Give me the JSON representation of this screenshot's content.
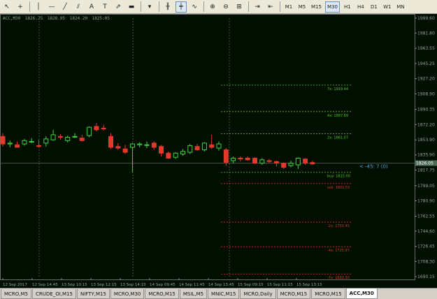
{
  "toolbar": {
    "tools": [
      {
        "name": "cursor-icon",
        "glyph": "↖",
        "active": false
      },
      {
        "name": "crosshair-icon",
        "glyph": "+",
        "active": false
      },
      {
        "name": "vertical-line-icon",
        "glyph": "│",
        "active": false
      },
      {
        "name": "horizontal-line-icon",
        "glyph": "—",
        "active": false
      },
      {
        "name": "trendline-icon",
        "glyph": "╱",
        "active": false
      },
      {
        "name": "channel-icon",
        "glyph": "⫽",
        "active": false
      },
      {
        "name": "text-icon",
        "glyph": "A",
        "active": false
      },
      {
        "name": "text-label-icon",
        "glyph": "T",
        "active": false
      },
      {
        "name": "arrow-tool-icon",
        "glyph": "⇗",
        "active": false
      },
      {
        "name": "chart-type-icon",
        "glyph": "▬",
        "active": false
      },
      {
        "name": "dropdown-icon",
        "glyph": "▾",
        "active": false
      }
    ],
    "chart_tools": [
      {
        "name": "bar-chart-icon",
        "glyph": "╫",
        "active": false
      },
      {
        "name": "candlestick-icon",
        "glyph": "╪",
        "active": true
      },
      {
        "name": "line-chart-icon",
        "glyph": "∿",
        "active": false
      },
      {
        "name": "zoom-in-icon",
        "glyph": "⊕",
        "active": false
      },
      {
        "name": "zoom-out-icon",
        "glyph": "⊖",
        "active": false
      },
      {
        "name": "tile-windows-icon",
        "glyph": "⊞",
        "active": false
      },
      {
        "name": "autoscroll-icon",
        "glyph": "⇥",
        "active": false
      },
      {
        "name": "chart-shift-icon",
        "glyph": "⇤",
        "active": false
      }
    ],
    "timeframes": [
      "M1",
      "M5",
      "M15",
      "M30",
      "H1",
      "H4",
      "D1",
      "W1",
      "MN"
    ],
    "active_timeframe": "M30"
  },
  "chart": {
    "ohlc_header": [
      "ACC,M30",
      "1826.75",
      "1828.95",
      "1824.20",
      "1825.05"
    ],
    "price_ticks": [
      "1999.60",
      "1981.80",
      "1963.55",
      "1945.25",
      "1927.20",
      "1908.90",
      "1890.35",
      "1872.20",
      "1853.90",
      "1835.90",
      "1817.75",
      "1799.05",
      "1780.90",
      "1762.55",
      "1744.60",
      "1726.45",
      "1708.30",
      "1690.15"
    ],
    "time_ticks": [
      "12 Sep 2017",
      "12 Sep 14:45",
      "13 Sep 10:15",
      "13 Sep 12:15",
      "13 Sep 14:15",
      "14 Sep 09:45",
      "14 Sep 11:45",
      "14 Sep 13:45",
      "15 Sep 09:15",
      "15 Sep 11:15",
      "15 Sep 13:15"
    ],
    "current_price_label": "1826.05",
    "trade_annotation": "< -45: 7 (0)",
    "levels": [
      {
        "label": "7x: 1919.44",
        "color": "#4cc81f"
      },
      {
        "label": "4x: 1887.69",
        "color": "#4cc81f"
      },
      {
        "label": "2x: 1861.07",
        "color": "#4cc81f"
      },
      {
        "label": "buy: 1815.00",
        "color": "#4cc81f"
      },
      {
        "label": "sell: 1801.55",
        "color": "#e03020"
      },
      {
        "label": "-2x: 1755.45",
        "color": "#e03020"
      },
      {
        "label": "-4x: 1725.97",
        "color": "#e03020"
      },
      {
        "label": "-7x: 1693.30",
        "color": "#e03020"
      }
    ]
  },
  "chart_data": {
    "type": "candlestick",
    "symbol": "ACC",
    "timeframe": "M30",
    "ylim": [
      1690.15,
      1999.6
    ],
    "bull_color": "#3ed23e",
    "bear_color": "#e23a2a",
    "candles": [
      {
        "o": 1858,
        "h": 1862,
        "l": 1846,
        "c": 1849
      },
      {
        "o": 1849,
        "h": 1853,
        "l": 1845,
        "c": 1850
      },
      {
        "o": 1848,
        "h": 1852,
        "l": 1845,
        "c": 1845
      },
      {
        "o": 1849,
        "h": 1855,
        "l": 1847,
        "c": 1853
      },
      {
        "o": 1852,
        "h": 1856,
        "l": 1850,
        "c": 1852
      },
      {
        "o": 1847,
        "h": 1854,
        "l": 1845,
        "c": 1846
      },
      {
        "o": 1850,
        "h": 1858,
        "l": 1846,
        "c": 1855
      },
      {
        "o": 1854,
        "h": 1866,
        "l": 1853,
        "c": 1860
      },
      {
        "o": 1858,
        "h": 1861,
        "l": 1854,
        "c": 1857
      },
      {
        "o": 1853,
        "h": 1859,
        "l": 1851,
        "c": 1857
      },
      {
        "o": 1858,
        "h": 1862,
        "l": 1856,
        "c": 1858
      },
      {
        "o": 1856,
        "h": 1860,
        "l": 1852,
        "c": 1853
      },
      {
        "o": 1859,
        "h": 1870,
        "l": 1857,
        "c": 1869
      },
      {
        "o": 1870,
        "h": 1874,
        "l": 1864,
        "c": 1866
      },
      {
        "o": 1868,
        "h": 1872,
        "l": 1865,
        "c": 1867
      },
      {
        "o": 1858,
        "h": 1862,
        "l": 1843,
        "c": 1845
      },
      {
        "o": 1846,
        "h": 1850,
        "l": 1842,
        "c": 1844
      },
      {
        "o": 1843,
        "h": 1848,
        "l": 1837,
        "c": 1839
      },
      {
        "o": 1845,
        "h": 1850,
        "l": 1815,
        "c": 1849
      },
      {
        "o": 1848,
        "h": 1851,
        "l": 1845,
        "c": 1849
      },
      {
        "o": 1848,
        "h": 1852,
        "l": 1844,
        "c": 1848
      },
      {
        "o": 1850,
        "h": 1852,
        "l": 1842,
        "c": 1845
      },
      {
        "o": 1846,
        "h": 1848,
        "l": 1834,
        "c": 1838
      },
      {
        "o": 1838,
        "h": 1840,
        "l": 1831,
        "c": 1832
      },
      {
        "o": 1833,
        "h": 1839,
        "l": 1831,
        "c": 1838
      },
      {
        "o": 1837,
        "h": 1843,
        "l": 1835,
        "c": 1840
      },
      {
        "o": 1839,
        "h": 1849,
        "l": 1837,
        "c": 1847
      },
      {
        "o": 1846,
        "h": 1849,
        "l": 1841,
        "c": 1842
      },
      {
        "o": 1842,
        "h": 1851,
        "l": 1840,
        "c": 1850
      },
      {
        "o": 1848,
        "h": 1860,
        "l": 1843,
        "c": 1845
      },
      {
        "o": 1844,
        "h": 1852,
        "l": 1841,
        "c": 1849
      },
      {
        "o": 1842,
        "h": 1844,
        "l": 1823,
        "c": 1827
      },
      {
        "o": 1829,
        "h": 1834,
        "l": 1826,
        "c": 1832
      },
      {
        "o": 1832,
        "h": 1834,
        "l": 1828,
        "c": 1831
      },
      {
        "o": 1832,
        "h": 1834,
        "l": 1829,
        "c": 1830
      },
      {
        "o": 1832,
        "h": 1833,
        "l": 1825,
        "c": 1826
      },
      {
        "o": 1826,
        "h": 1832,
        "l": 1824,
        "c": 1830
      },
      {
        "o": 1829,
        "h": 1831,
        "l": 1826,
        "c": 1828
      },
      {
        "o": 1828,
        "h": 1829,
        "l": 1822,
        "c": 1826
      },
      {
        "o": 1826,
        "h": 1827,
        "l": 1819,
        "c": 1821
      },
      {
        "o": 1823,
        "h": 1829,
        "l": 1821,
        "c": 1826
      },
      {
        "o": 1824,
        "h": 1833,
        "l": 1819,
        "c": 1832
      },
      {
        "o": 1831,
        "h": 1832,
        "l": 1824,
        "c": 1826
      },
      {
        "o": 1826.75,
        "h": 1828.95,
        "l": 1824.2,
        "c": 1825.05
      }
    ]
  },
  "tabs": {
    "items": [
      "MCRO,M5",
      "CRUDE_OI,M15",
      "NIFTY,M15",
      "MCRO,M30",
      "MCRO,M15",
      "MSIL,M5",
      "MNIC,M15",
      "MCRO,Daily",
      "MCRO,M15",
      "MCRO,M15",
      "ACC,M30"
    ],
    "active_index": 10
  }
}
